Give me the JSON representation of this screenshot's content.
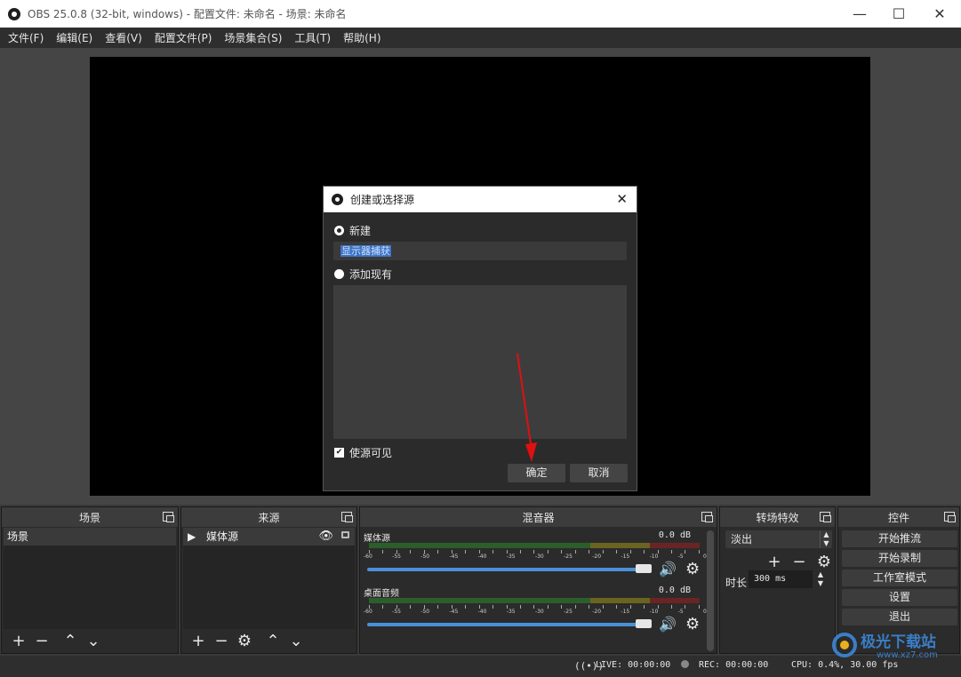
{
  "window": {
    "title": "OBS 25.0.8 (32-bit, windows) - 配置文件: 未命名 - 场景: 未命名",
    "minimize": "—",
    "maximize": "☐",
    "close": "✕"
  },
  "menu": [
    "文件(F)",
    "编辑(E)",
    "查看(V)",
    "配置文件(P)",
    "场景集合(S)",
    "工具(T)",
    "帮助(H)"
  ],
  "dialog": {
    "title": "创建或选择源",
    "close": "✕",
    "create_new": "新建",
    "name_value": "显示器捕获",
    "add_existing": "添加现有",
    "make_visible": "使源可见",
    "make_visible_checked": true,
    "ok": "确定",
    "cancel": "取消"
  },
  "docks": {
    "scenes": {
      "title": "场景",
      "items": [
        "场景"
      ]
    },
    "sources": {
      "title": "来源",
      "items": [
        "媒体源"
      ]
    },
    "mixer": {
      "title": "混音器",
      "channels": [
        {
          "name": "媒体源",
          "db": "0.0 dB"
        },
        {
          "name": "桌面音频",
          "db": "0.0 dB"
        }
      ],
      "tick_labels": [
        "-60",
        "-55",
        "-50",
        "-45",
        "-40",
        "-35",
        "-30",
        "-25",
        "-20",
        "-15",
        "-10",
        "-5",
        "0"
      ]
    },
    "transitions": {
      "title": "转场特效",
      "selected": "淡出",
      "duration_label": "时长",
      "duration_value": "300 ms"
    },
    "controls": {
      "title": "控件",
      "buttons": [
        "开始推流",
        "开始录制",
        "工作室模式",
        "设置",
        "退出"
      ]
    }
  },
  "status": {
    "live": "LIVE: 00:00:00",
    "rec": "REC: 00:00:00",
    "cpu": "CPU: 0.4%, 30.00 fps"
  },
  "watermark": {
    "text": "极光下载站",
    "url": "www.xz7.com"
  },
  "icons": {
    "add": "add-icon",
    "remove": "remove-icon",
    "up": "arrow-up-icon",
    "down": "arrow-down-icon",
    "gear": "gear-icon",
    "eye": "eye-icon",
    "lock": "lock-icon",
    "speaker": "speaker-icon",
    "play": "play-icon"
  },
  "colors": {
    "accent": "#4a90d9",
    "selection": "#3d74c4",
    "arrow": "#e01010"
  }
}
